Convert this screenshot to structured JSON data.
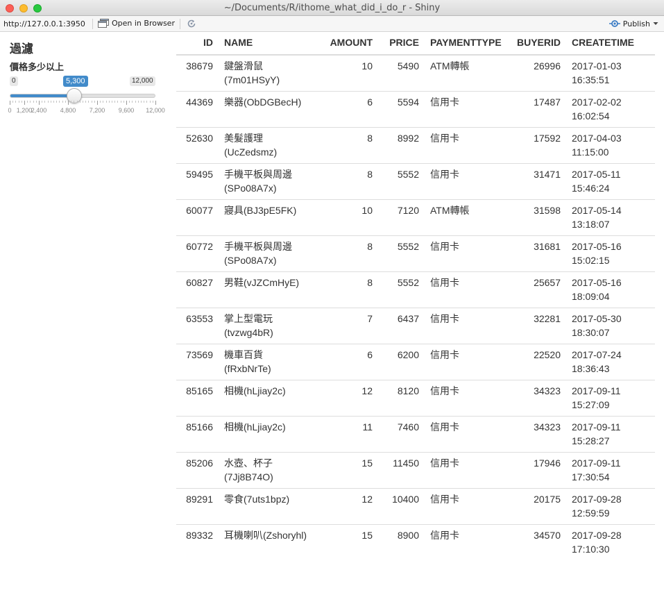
{
  "window": {
    "title": "~/Documents/R/ithome_what_did_i_do_r - Shiny"
  },
  "toolbar": {
    "url": "http://127.0.0.1:3950",
    "open_label": "Open in Browser",
    "publish_label": "Publish"
  },
  "sidebar": {
    "title": "過濾",
    "slider": {
      "label": "價格多少以上",
      "min_label": "0",
      "max_label": "12,000",
      "value_label": "5,300",
      "min": 0,
      "max": 12000,
      "value": 5300,
      "tick_labels": [
        "0",
        "1,200",
        "2,400",
        "4,800",
        "7,200",
        "9,600",
        "12,000"
      ],
      "tick_values": [
        0,
        1200,
        2400,
        4800,
        7200,
        9600,
        12000
      ],
      "accent": "#428bca"
    }
  },
  "table": {
    "headers": [
      "ID",
      "NAME",
      "AMOUNT",
      "PRICE",
      "PAYMENTTYPE",
      "BUYERID",
      "CREATETIME"
    ],
    "rows": [
      [
        "38679",
        "鍵盤滑鼠",
        "(7m01HSyY)",
        "10",
        "5490",
        "ATM轉帳",
        "26996",
        "2017-01-03",
        "16:35:51"
      ],
      [
        "44369",
        "樂器(ObDGBecH)",
        "",
        "6",
        "5594",
        "信用卡",
        "17487",
        "2017-02-02",
        "16:02:54"
      ],
      [
        "52630",
        "美髮護理",
        "(UcZedsmz)",
        "8",
        "8992",
        "信用卡",
        "17592",
        "2017-04-03",
        "11:15:00"
      ],
      [
        "59495",
        "手機平板與周邊",
        "(SPo08A7x)",
        "8",
        "5552",
        "信用卡",
        "31471",
        "2017-05-11",
        "15:46:24"
      ],
      [
        "60077",
        "寢具(BJ3pE5FK)",
        "",
        "10",
        "7120",
        "ATM轉帳",
        "31598",
        "2017-05-14",
        "13:18:07"
      ],
      [
        "60772",
        "手機平板與周邊",
        "(SPo08A7x)",
        "8",
        "5552",
        "信用卡",
        "31681",
        "2017-05-16",
        "15:02:15"
      ],
      [
        "60827",
        "男鞋(vJZCmHyE)",
        "",
        "8",
        "5552",
        "信用卡",
        "25657",
        "2017-05-16",
        "18:09:04"
      ],
      [
        "63553",
        "掌上型電玩",
        "(tvzwg4bR)",
        "7",
        "6437",
        "信用卡",
        "32281",
        "2017-05-30",
        "18:30:07"
      ],
      [
        "73569",
        "機車百貨",
        "(fRxbNrTe)",
        "6",
        "6200",
        "信用卡",
        "22520",
        "2017-07-24",
        "18:36:43"
      ],
      [
        "85165",
        "相機(hLjiay2c)",
        "",
        "12",
        "8120",
        "信用卡",
        "34323",
        "2017-09-11",
        "15:27:09"
      ],
      [
        "85166",
        "相機(hLjiay2c)",
        "",
        "11",
        "7460",
        "信用卡",
        "34323",
        "2017-09-11",
        "15:28:27"
      ],
      [
        "85206",
        "水壺、杯子",
        "(7Jj8B74O)",
        "15",
        "11450",
        "信用卡",
        "17946",
        "2017-09-11",
        "17:30:54"
      ],
      [
        "89291",
        "零食(7uts1bpz)",
        "",
        "12",
        "10400",
        "信用卡",
        "20175",
        "2017-09-28",
        "12:59:59"
      ],
      [
        "89332",
        "耳機喇叭(Zshoryhl)",
        "",
        "15",
        "8900",
        "信用卡",
        "34570",
        "2017-09-28",
        "17:10:30"
      ]
    ]
  }
}
